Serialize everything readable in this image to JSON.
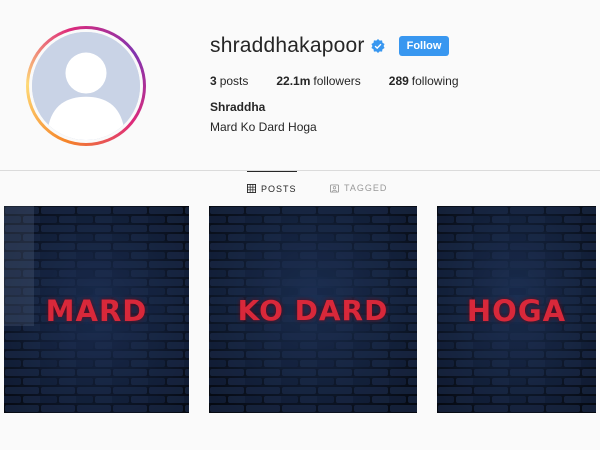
{
  "profile": {
    "username": "shraddhakapoor",
    "verified": true,
    "follow_label": "Follow",
    "full_name": "Shraddha",
    "bio": "Mard Ko Dard Hoga"
  },
  "stats": {
    "posts_count": "3",
    "posts_label": "posts",
    "followers_count": "22.1m",
    "followers_label": "followers",
    "following_count": "289",
    "following_label": "following"
  },
  "tabs": [
    {
      "label": "POSTS",
      "active": true,
      "icon": "grid-icon"
    },
    {
      "label": "TAGGED",
      "active": false,
      "icon": "tag-icon"
    }
  ],
  "posts": [
    {
      "text": "MARD"
    },
    {
      "text": "KO DARD"
    },
    {
      "text": "HOGA"
    }
  ],
  "colors": {
    "accent": "#3897f0",
    "verified": "#3897f0",
    "post_text": "#d8283a",
    "post_bg": "#0c1424"
  }
}
